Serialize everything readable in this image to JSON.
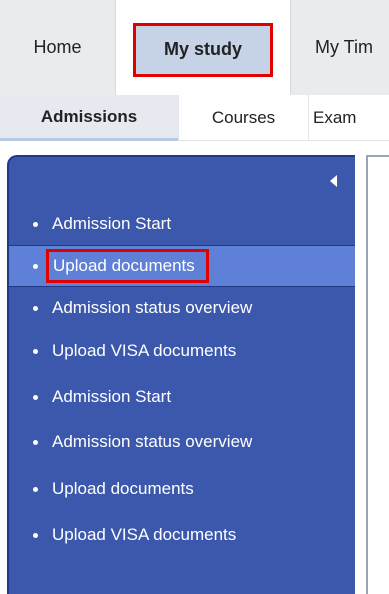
{
  "top_tabs": [
    {
      "label": "Home"
    },
    {
      "label": "My study",
      "active": true
    },
    {
      "label": "My Tim"
    }
  ],
  "sub_tabs": [
    {
      "label": "Admissions",
      "active": true
    },
    {
      "label": "Courses"
    },
    {
      "label": "Exam"
    }
  ],
  "nav": {
    "collapse_icon": "chevron-left-icon",
    "items": [
      {
        "label": "Admission Start"
      },
      {
        "label": "Upload documents",
        "selected": true
      },
      {
        "label": "Admission status overview"
      },
      {
        "label": "Upload VISA documents"
      },
      {
        "label": "Admission Start"
      },
      {
        "label": "Admission status overview"
      },
      {
        "label": "Upload documents"
      },
      {
        "label": "Upload VISA documents"
      }
    ]
  },
  "colors": {
    "nav_background": "#3b58ad",
    "nav_selected": "#5e80d6",
    "highlight_border": "#e10000"
  }
}
